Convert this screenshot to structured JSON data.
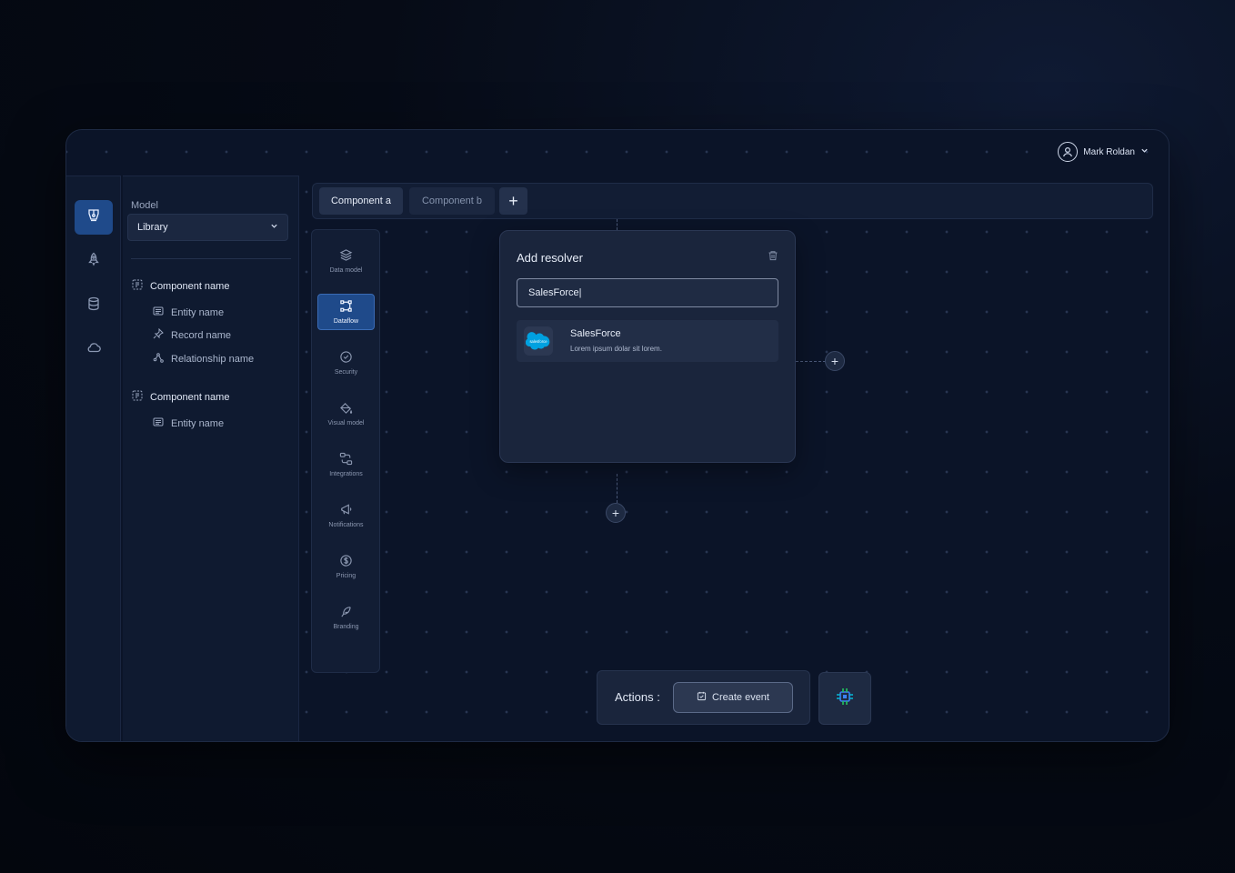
{
  "user": {
    "name": "Mark Roldan"
  },
  "rail": {
    "items": [
      {
        "icon": "pen-tool-icon",
        "active": true
      },
      {
        "icon": "rocket-icon",
        "active": false
      },
      {
        "icon": "database-icon",
        "active": false
      },
      {
        "icon": "cloud-icon",
        "active": false
      }
    ]
  },
  "panel": {
    "model_label": "Model",
    "model_value": "Library",
    "tree": [
      {
        "label": "Component name",
        "type": "group"
      },
      {
        "label": "Entity name",
        "type": "entity"
      },
      {
        "label": "Record name",
        "type": "record"
      },
      {
        "label": "Relationship name",
        "type": "relationship"
      },
      {
        "label": "Component name",
        "type": "group"
      },
      {
        "label": "Entity name",
        "type": "entity"
      }
    ]
  },
  "tabs": {
    "items": [
      "Component a",
      "Component b"
    ],
    "add_label": "+"
  },
  "tools": [
    {
      "label": "Data model",
      "icon": "layers-icon",
      "active": false
    },
    {
      "label": "Dataflow",
      "icon": "dataflow-icon",
      "active": true
    },
    {
      "label": "Security",
      "icon": "shield-icon",
      "active": false
    },
    {
      "label": "Visual model",
      "icon": "paint-bucket-icon",
      "active": false
    },
    {
      "label": "Integrations",
      "icon": "integrations-icon",
      "active": false
    },
    {
      "label": "Notifications",
      "icon": "megaphone-icon",
      "active": false
    },
    {
      "label": "Pricing",
      "icon": "dollar-coin-icon",
      "active": false
    },
    {
      "label": "Branding",
      "icon": "feather-icon",
      "active": false
    }
  ],
  "resolver": {
    "title": "Add resolver",
    "search_value": "SalesForce|",
    "result": {
      "name": "SalesForce",
      "description": "Lorem ipsum dolar sit lorem.",
      "logo_text": "salesforce"
    }
  },
  "canvas": {
    "add_label": "+"
  },
  "actions": {
    "label": "Actions :",
    "create_event": "Create event"
  },
  "colors": {
    "accent": "#1f4a8a",
    "panel_bg": "#0f1a30",
    "card_bg": "#1a253c",
    "salesforce_blue": "#00a1e0"
  }
}
